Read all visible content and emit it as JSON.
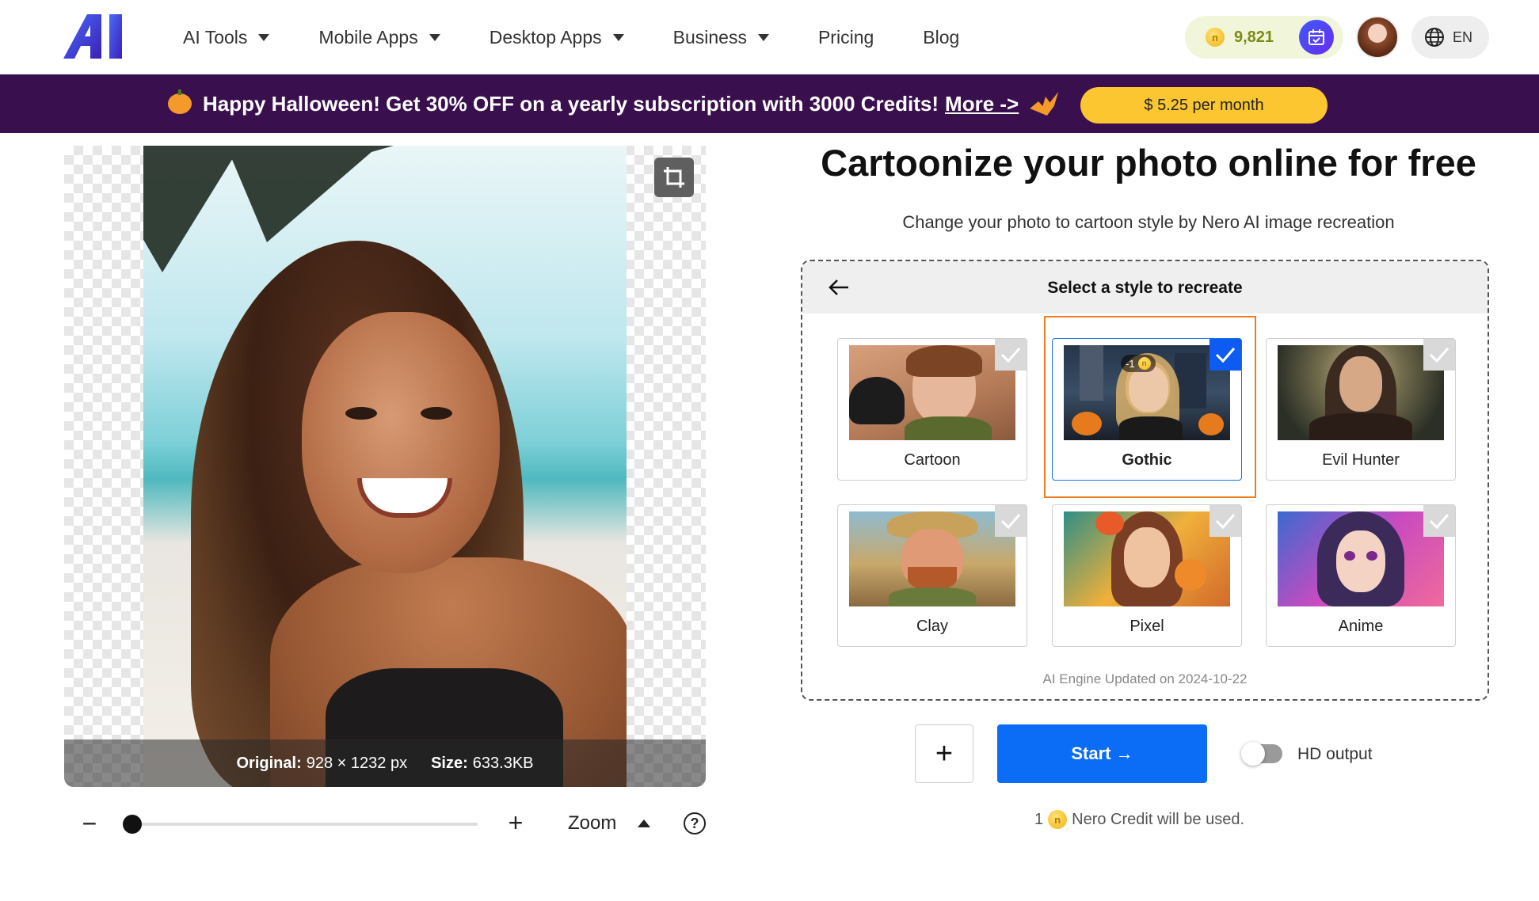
{
  "header": {
    "nav": [
      {
        "label": "AI Tools",
        "has_dropdown": true
      },
      {
        "label": "Mobile Apps",
        "has_dropdown": true
      },
      {
        "label": "Desktop Apps",
        "has_dropdown": true
      },
      {
        "label": "Business",
        "has_dropdown": true
      },
      {
        "label": "Pricing",
        "has_dropdown": false
      },
      {
        "label": "Blog",
        "has_dropdown": false
      }
    ],
    "credits": "9,821",
    "language": "EN"
  },
  "banner": {
    "text": "Happy Halloween! Get 30% OFF on a yearly subscription with 3000 Credits!",
    "more_link": "More ->",
    "price_button": "$ 5.25 per month",
    "background": "#3a0f4e"
  },
  "preview": {
    "original_label": "Original:",
    "original_value": "928 × 1232 px",
    "size_label": "Size:",
    "size_value": "633.3KB",
    "zoom_label": "Zoom",
    "zoom_level": 0.0
  },
  "main": {
    "title": "Cartoonize your photo online for free",
    "subtitle": "Change your photo to cartoon style by Nero AI image recreation",
    "panel_title": "Select a style to recreate",
    "styles": [
      {
        "label": "Cartoon",
        "selected": false
      },
      {
        "label": "Gothic",
        "selected": true
      },
      {
        "label": "Evil Hunter",
        "selected": false
      },
      {
        "label": "Clay",
        "selected": false
      },
      {
        "label": "Pixel",
        "selected": false
      },
      {
        "label": "Anime",
        "selected": false
      }
    ],
    "engine_note": "AI Engine Updated on 2024-10-22",
    "start_label": "Start →",
    "hd_label": "HD output",
    "hd_enabled": false,
    "credit_prefix": "1",
    "credit_suffix": "Nero Credit will be used."
  },
  "colors": {
    "accent_blue": "#0b6cf5",
    "selection_orange": "#f47c20",
    "price_yellow": "#fcc631"
  }
}
